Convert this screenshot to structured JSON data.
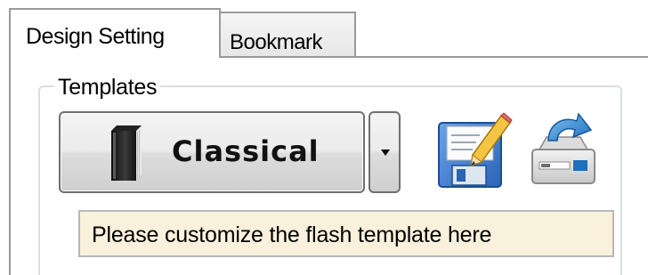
{
  "tabs": [
    {
      "label": "Design Setting",
      "active": true
    },
    {
      "label": "Bookmark",
      "active": false
    }
  ],
  "templates_group": {
    "legend": "Templates",
    "selected_template": "Classical",
    "hint": "Please customize the flash template here"
  },
  "icons": {
    "template": "book-icon",
    "dropdown": "chevron-down-icon",
    "save": "save-template-icon",
    "load": "load-template-icon"
  },
  "colors": {
    "hint_background": "#f9f1dc",
    "save_icon_blue": "#3f79c9",
    "load_icon_blue": "#2f83cf"
  }
}
